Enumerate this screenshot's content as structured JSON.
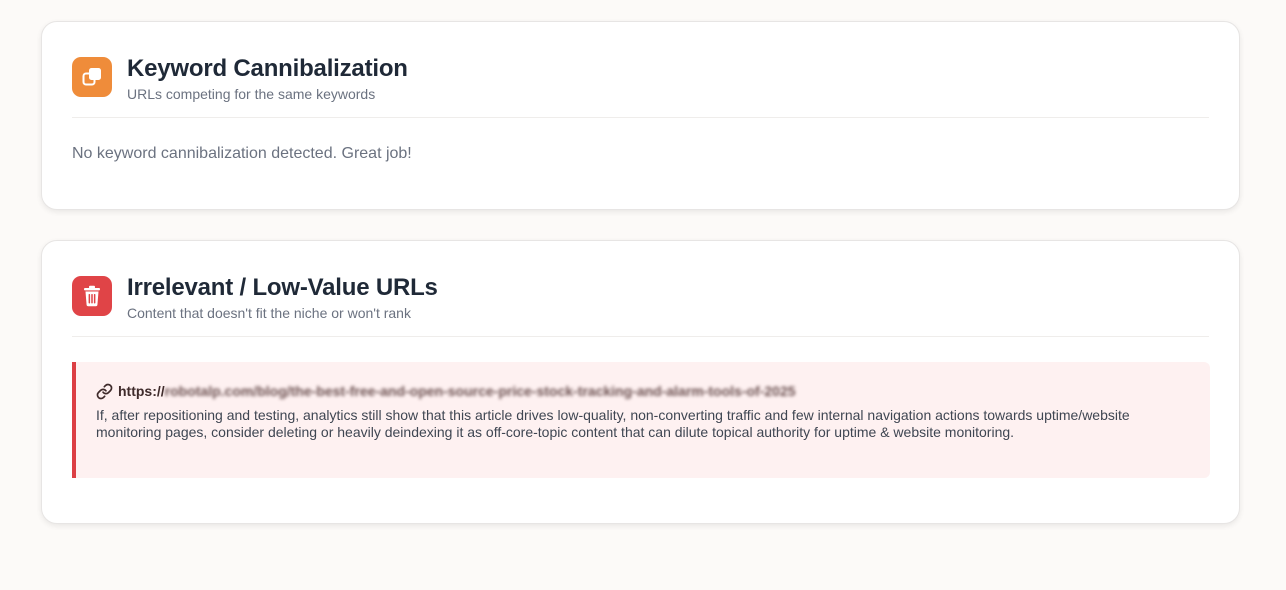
{
  "sections": [
    {
      "title": "Keyword Cannibalization",
      "subtitle": "URLs competing for the same keywords",
      "icon": "copy-icon",
      "accent": "#ef8c3a",
      "empty_message": "No keyword cannibalization detected. Great job!"
    },
    {
      "title": "Irrelevant / Low-Value URLs",
      "subtitle": "Content that doesn't fit the niche or won't rank",
      "icon": "trash-icon",
      "accent": "#e04447",
      "items": [
        {
          "url_prefix": "https://",
          "url_rest": "robotalp.com/blog/the-best-free-and-open-source-price-stock-tracking-and-alarm-tools-of-2025",
          "description": "If, after repositioning and testing, analytics still show that this article drives low-quality, non-converting traffic and few internal navigation actions towards uptime/website monitoring pages, consider deleting or heavily deindexing it as off-core-topic content that can dilute topical authority for uptime & website monitoring."
        }
      ]
    }
  ]
}
